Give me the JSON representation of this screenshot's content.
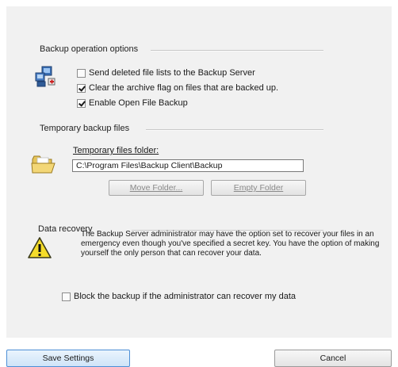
{
  "backup_options": {
    "title": "Backup operation options",
    "send_deleted": {
      "label": "Send deleted file lists to the Backup Server",
      "checked": false
    },
    "clear_archive": {
      "label": "Clear the archive flag on files that are backed up.",
      "checked": true
    },
    "open_file": {
      "label": "Enable Open File Backup",
      "checked": true
    },
    "icon": "computer-network-icon"
  },
  "temp_files": {
    "title": "Temporary backup files",
    "folder_label": "Temporary files folder:",
    "folder_value": "C:\\Program Files\\Backup Client\\Backup",
    "move_button": "Move Folder...",
    "empty_button": "Empty Folder",
    "icon": "open-folder-icon"
  },
  "data_recovery": {
    "title": "Data recovery",
    "notice": "The Backup Server administrator may have the option set to recover your files in an emergency even though you've specified a secret key.  You have the option of making yourself the only person that can recover your data.",
    "block_label": "Block the backup if the administrator can recover my data",
    "block_checked": false,
    "icon": "warning-icon"
  },
  "footer": {
    "save_label": "Save Settings",
    "cancel_label": "Cancel"
  }
}
